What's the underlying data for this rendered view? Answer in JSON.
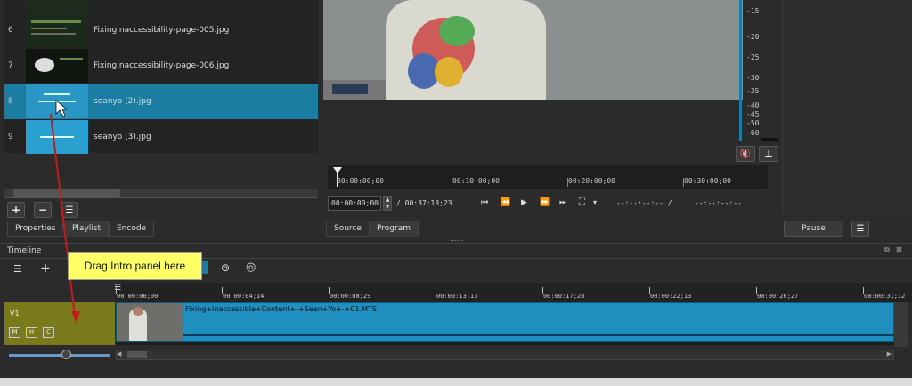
{
  "playlist": {
    "items": [
      {
        "num": "6",
        "name": "FixingInaccessibility-page-005.jpg"
      },
      {
        "num": "7",
        "name": "FixingInaccessibility-page-006.jpg"
      },
      {
        "num": "8",
        "name": "seanyo (2).jpg"
      },
      {
        "num": "9",
        "name": "seanyo (3).jpg"
      }
    ],
    "add_label": "+",
    "remove_label": "−",
    "menu_label": "☰"
  },
  "tabs": {
    "properties": "Properties",
    "playlist": "Playlist",
    "encode": "Encode",
    "source": "Source",
    "program": "Program"
  },
  "player": {
    "ruler_ticks": [
      "00:00:00;00",
      "00:10:00;00",
      "00:20:00;00",
      "00:30:00;00"
    ],
    "timecode": "00:00:00;00",
    "duration": "/ 00:37:13;23",
    "in_point": "--:--:--:-- /",
    "out_point": "--:--:--:--"
  },
  "audio_meter": {
    "labels": [
      "-15",
      "-20",
      "-25",
      "-30",
      "-35",
      "-40",
      "-45",
      "-50",
      "-60"
    ]
  },
  "right_panel": {
    "pause_label": "Pause",
    "menu_label": "☰"
  },
  "timeline": {
    "title": "Timeline",
    "callout": "Drag Intro panel here",
    "ticks": [
      "00:00:00;00",
      "00:00:04;14",
      "00:00:08;29",
      "00:00:13;13",
      "00:00:17;28",
      "00:00:22;13",
      "00:00:26;27",
      "00:00:31;12"
    ],
    "track": {
      "name": "V1",
      "mute": "M",
      "hide": "H",
      "composite": "C"
    },
    "clip_name": "Fixing+Inaccessible+Content+-+Sean+Yo+-+01.MTS"
  },
  "colors": {
    "selection": "#1a7da1",
    "clip": "#1e8fbf",
    "track_header": "#7a7a1a",
    "callout": "#ffff66",
    "arrow": "#c41a1a"
  }
}
